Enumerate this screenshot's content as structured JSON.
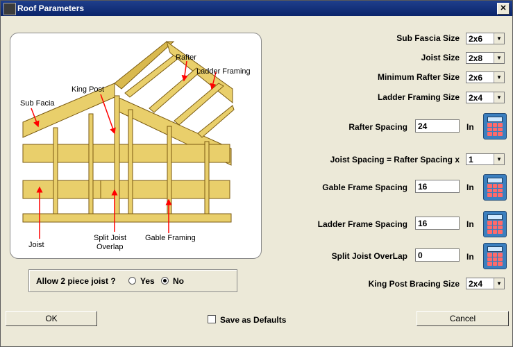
{
  "window": {
    "title": "Roof Parameters",
    "close_glyph": "✕"
  },
  "diagram": {
    "labels": {
      "rafter": "Rafter",
      "ladder_framing": "Ladder Framing",
      "king_post": "King Post",
      "sub_facia": "Sub Facia",
      "joist": "Joist",
      "split_joist_1": "Split Joist",
      "split_joist_2": "Overlap",
      "gable_framing": "Gable Framing"
    },
    "wood_color": "#e9cf6b",
    "arrow_color": "#ff0000"
  },
  "params": {
    "sub_fascia": {
      "label": "Sub Fascia Size",
      "value": "2x6"
    },
    "joist_size": {
      "label": "Joist Size",
      "value": "2x8"
    },
    "min_rafter": {
      "label": "Minimum Rafter Size",
      "value": "2x6"
    },
    "ladder_framing_size": {
      "label": "Ladder Framing Size",
      "value": "2x4"
    },
    "rafter_spacing": {
      "label": "Rafter Spacing",
      "value": "24",
      "unit": "In"
    },
    "joist_spacing": {
      "label": "Joist Spacing = Rafter Spacing x",
      "value": "1"
    },
    "gable_spacing": {
      "label": "Gable Frame Spacing",
      "value": "16",
      "unit": "In"
    },
    "ladder_spacing": {
      "label": "Ladder Frame Spacing",
      "value": "16",
      "unit": "In"
    },
    "split_overlap": {
      "label": "Split Joist OverLap",
      "value": "0",
      "unit": "In"
    },
    "king_post": {
      "label": "King Post Bracing Size",
      "value": "2x4"
    }
  },
  "joist_group": {
    "question": "Allow 2 piece joist ?",
    "yes": "Yes",
    "no": "No",
    "selected": "No"
  },
  "footer": {
    "ok": "OK",
    "save_defaults": "Save as Defaults",
    "cancel": "Cancel"
  }
}
